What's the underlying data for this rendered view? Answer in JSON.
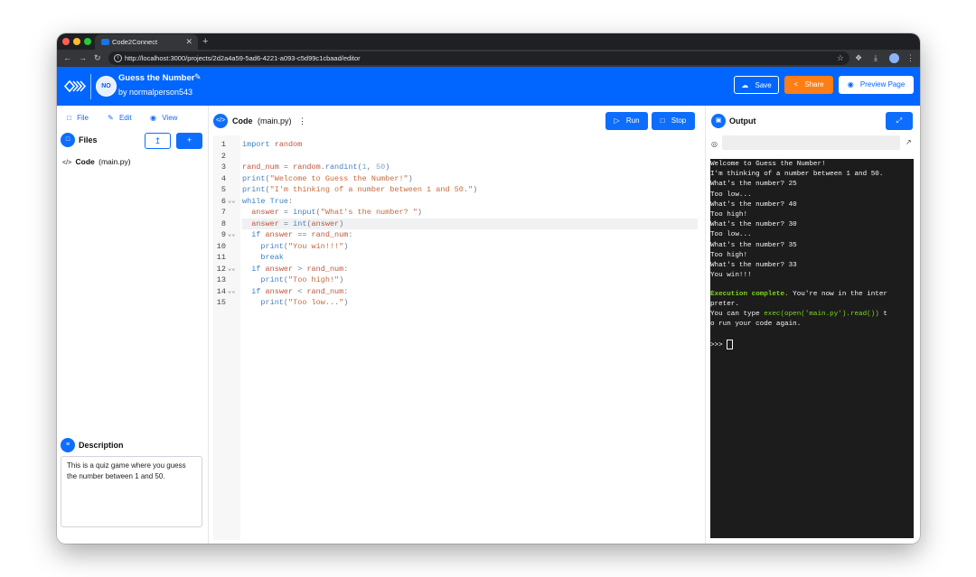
{
  "browser": {
    "tab_title": "Code2Connect",
    "tab_close": "✕",
    "new_tab": "+",
    "url": "http://localhost:3000/projects/2d2a4a59-5ad6-4221-a093-c5d99c1cbaad/editor"
  },
  "header": {
    "avatar_initials": "NO",
    "project_title": "Guess the Number",
    "author": "by normalperson543",
    "save_label": "Save",
    "share_label": "Share",
    "preview_label": "Preview Page"
  },
  "sidebar": {
    "menu": [
      {
        "label": "File",
        "icon": "file-icon"
      },
      {
        "label": "Edit",
        "icon": "pencil-icon"
      },
      {
        "label": "View",
        "icon": "eye-icon"
      }
    ],
    "files_heading": "Files",
    "file_item": {
      "name": "Code",
      "filename": "(main.py)"
    },
    "description_heading": "Description",
    "description_text": "This is a quiz game where you guess the number between 1 and 50."
  },
  "editor": {
    "title": "Code",
    "filename": "(main.py)",
    "menu_dots": "⋮",
    "run_label": "Run",
    "stop_label": "Stop",
    "active_line": 8,
    "folded_lines": [
      6,
      9,
      12,
      14
    ],
    "lines": [
      "import random",
      "",
      "rand_num = random.randint(1, 50)",
      "print(\"Welcome to Guess the Number!\")",
      "print(\"I'm thinking of a number between 1 and 50.\")",
      "while True:",
      "  answer = input(\"What's the number? \")",
      "  answer = int(answer)",
      "  if answer == rand_num:",
      "    print(\"You win!!!\")",
      "    break",
      "  if answer > rand_num:",
      "    print(\"Too high!\")",
      "  if answer < rand_num:",
      "    print(\"Too low...\")"
    ]
  },
  "output": {
    "title": "Output",
    "url_value": "",
    "lines": [
      "Welcome to Guess the Number!",
      "I'm thinking of a number between 1 and 50.",
      "What's the number? 25",
      "Too low...",
      "What's the number? 40",
      "Too high!",
      "What's the number? 30",
      "Too low...",
      "What's the number? 35",
      "Too high!",
      "What's the number? 33",
      "You win!!!"
    ],
    "complete_bold": "Execution complete.",
    "complete_rest": " You're now in the inter",
    "complete_wrap": "preter.",
    "hint_before": "You can type ",
    "hint_code": "exec(open('main.py').read())",
    "hint_after": " t",
    "hint_wrap": "o run your code again.",
    "prompt": ">>> "
  },
  "colors": {
    "brand_blue": "#0066ff",
    "button_blue": "#0d6efd",
    "share_orange": "#fd7e14",
    "terminal_bg": "#1c1c1c",
    "terminal_green": "#7ed321"
  }
}
